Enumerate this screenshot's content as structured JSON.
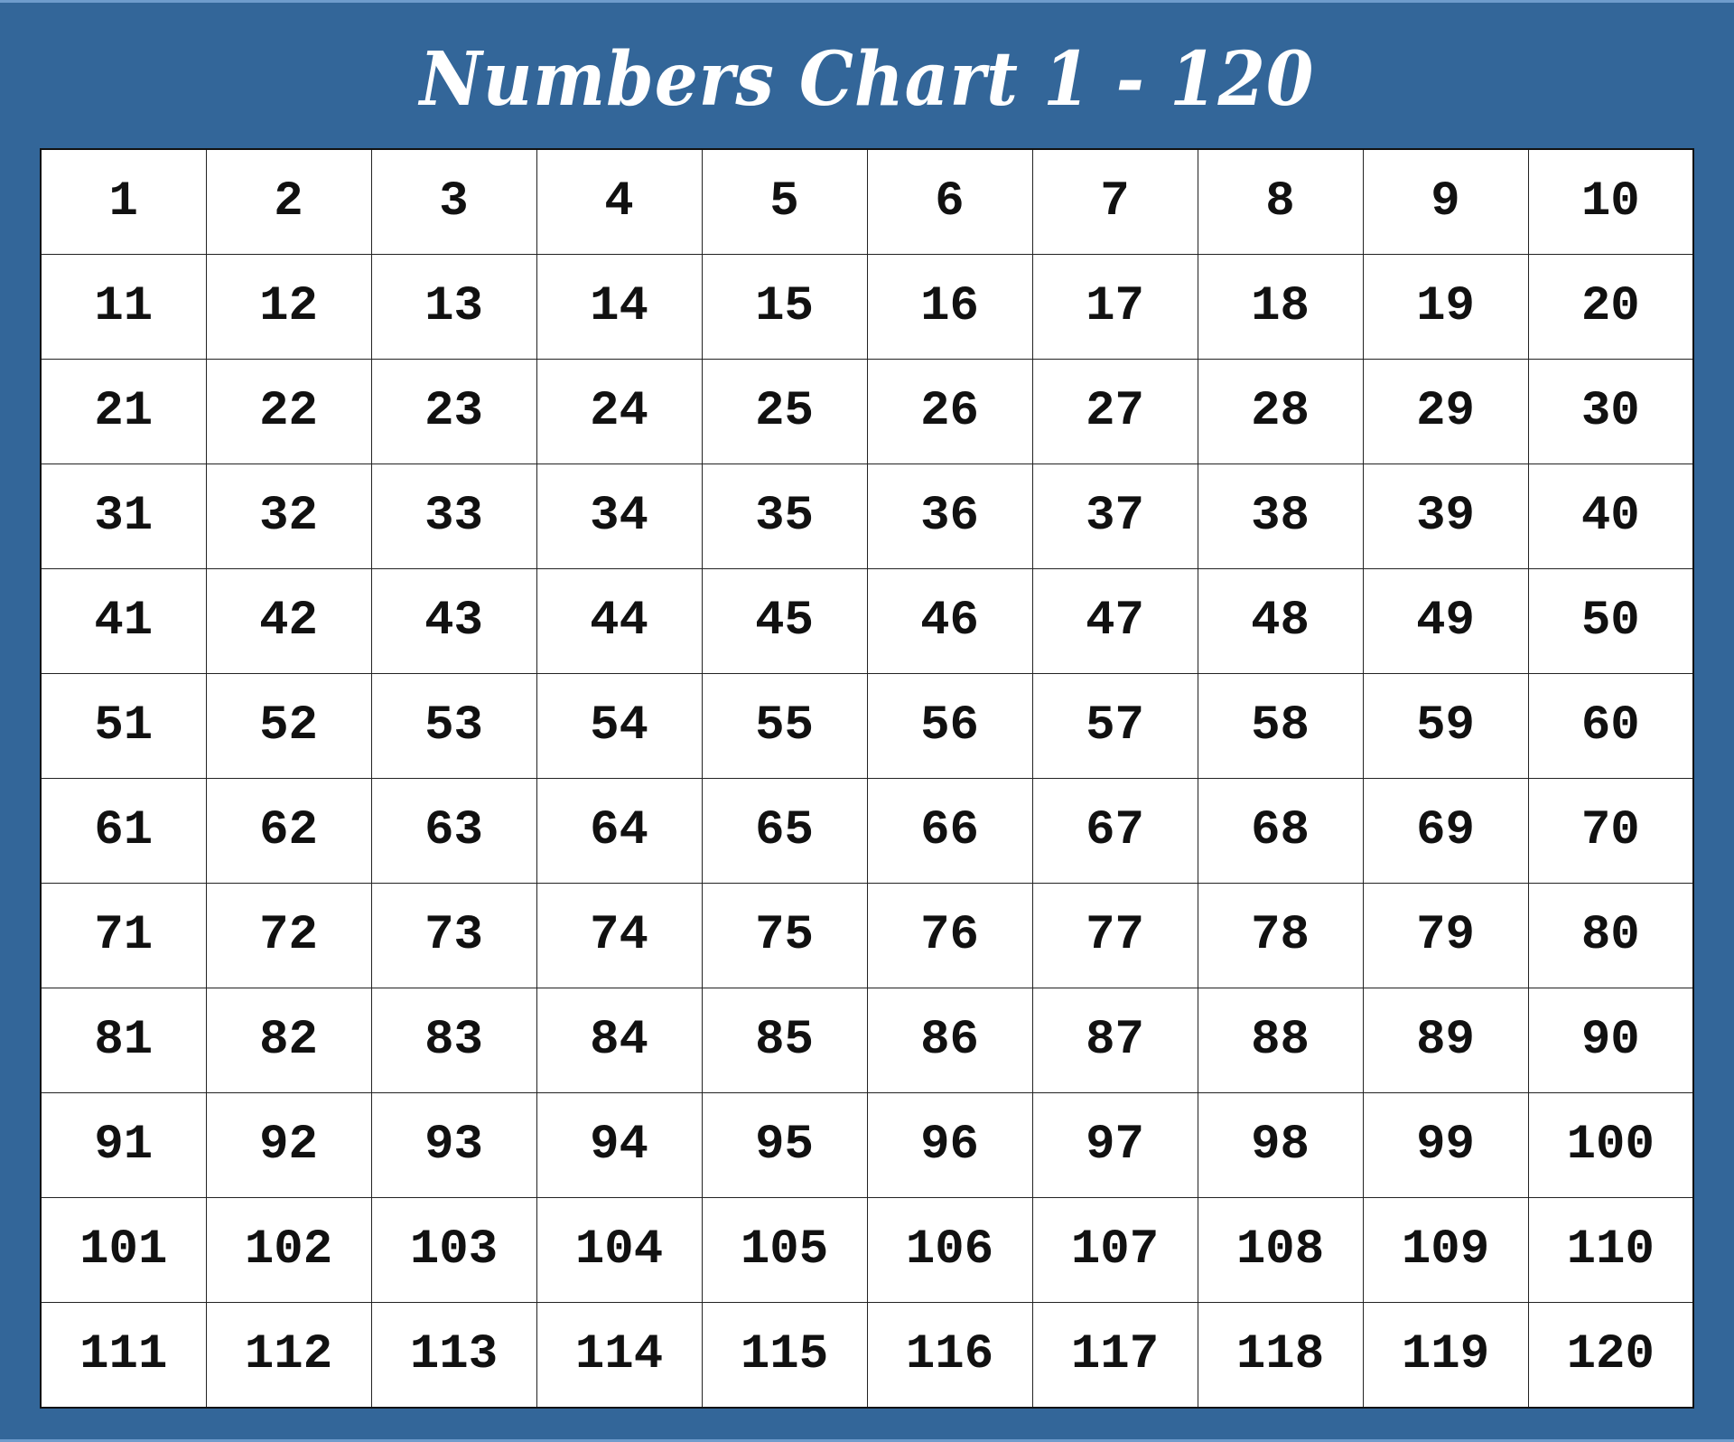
{
  "title": "Numbers Chart 1 - 120",
  "colors": {
    "background": "#336699",
    "cell": "#ffffff",
    "text": "#111111",
    "title": "#ffffff"
  },
  "grid": {
    "columns": 10,
    "rows": [
      [
        "1",
        "2",
        "3",
        "4",
        "5",
        "6",
        "7",
        "8",
        "9",
        "10"
      ],
      [
        "11",
        "12",
        "13",
        "14",
        "15",
        "16",
        "17",
        "18",
        "19",
        "20"
      ],
      [
        "21",
        "22",
        "23",
        "24",
        "25",
        "26",
        "27",
        "28",
        "29",
        "30"
      ],
      [
        "31",
        "32",
        "33",
        "34",
        "35",
        "36",
        "37",
        "38",
        "39",
        "40"
      ],
      [
        "41",
        "42",
        "43",
        "44",
        "45",
        "46",
        "47",
        "48",
        "49",
        "50"
      ],
      [
        "51",
        "52",
        "53",
        "54",
        "55",
        "56",
        "57",
        "58",
        "59",
        "60"
      ],
      [
        "61",
        "62",
        "63",
        "64",
        "65",
        "66",
        "67",
        "68",
        "69",
        "70"
      ],
      [
        "71",
        "72",
        "73",
        "74",
        "75",
        "76",
        "77",
        "78",
        "79",
        "80"
      ],
      [
        "81",
        "82",
        "83",
        "84",
        "85",
        "86",
        "87",
        "88",
        "89",
        "90"
      ],
      [
        "91",
        "92",
        "93",
        "94",
        "95",
        "96",
        "97",
        "98",
        "99",
        "100"
      ],
      [
        "101",
        "102",
        "103",
        "104",
        "105",
        "106",
        "107",
        "108",
        "109",
        "110"
      ],
      [
        "111",
        "112",
        "113",
        "114",
        "115",
        "116",
        "117",
        "118",
        "119",
        "120"
      ]
    ]
  }
}
